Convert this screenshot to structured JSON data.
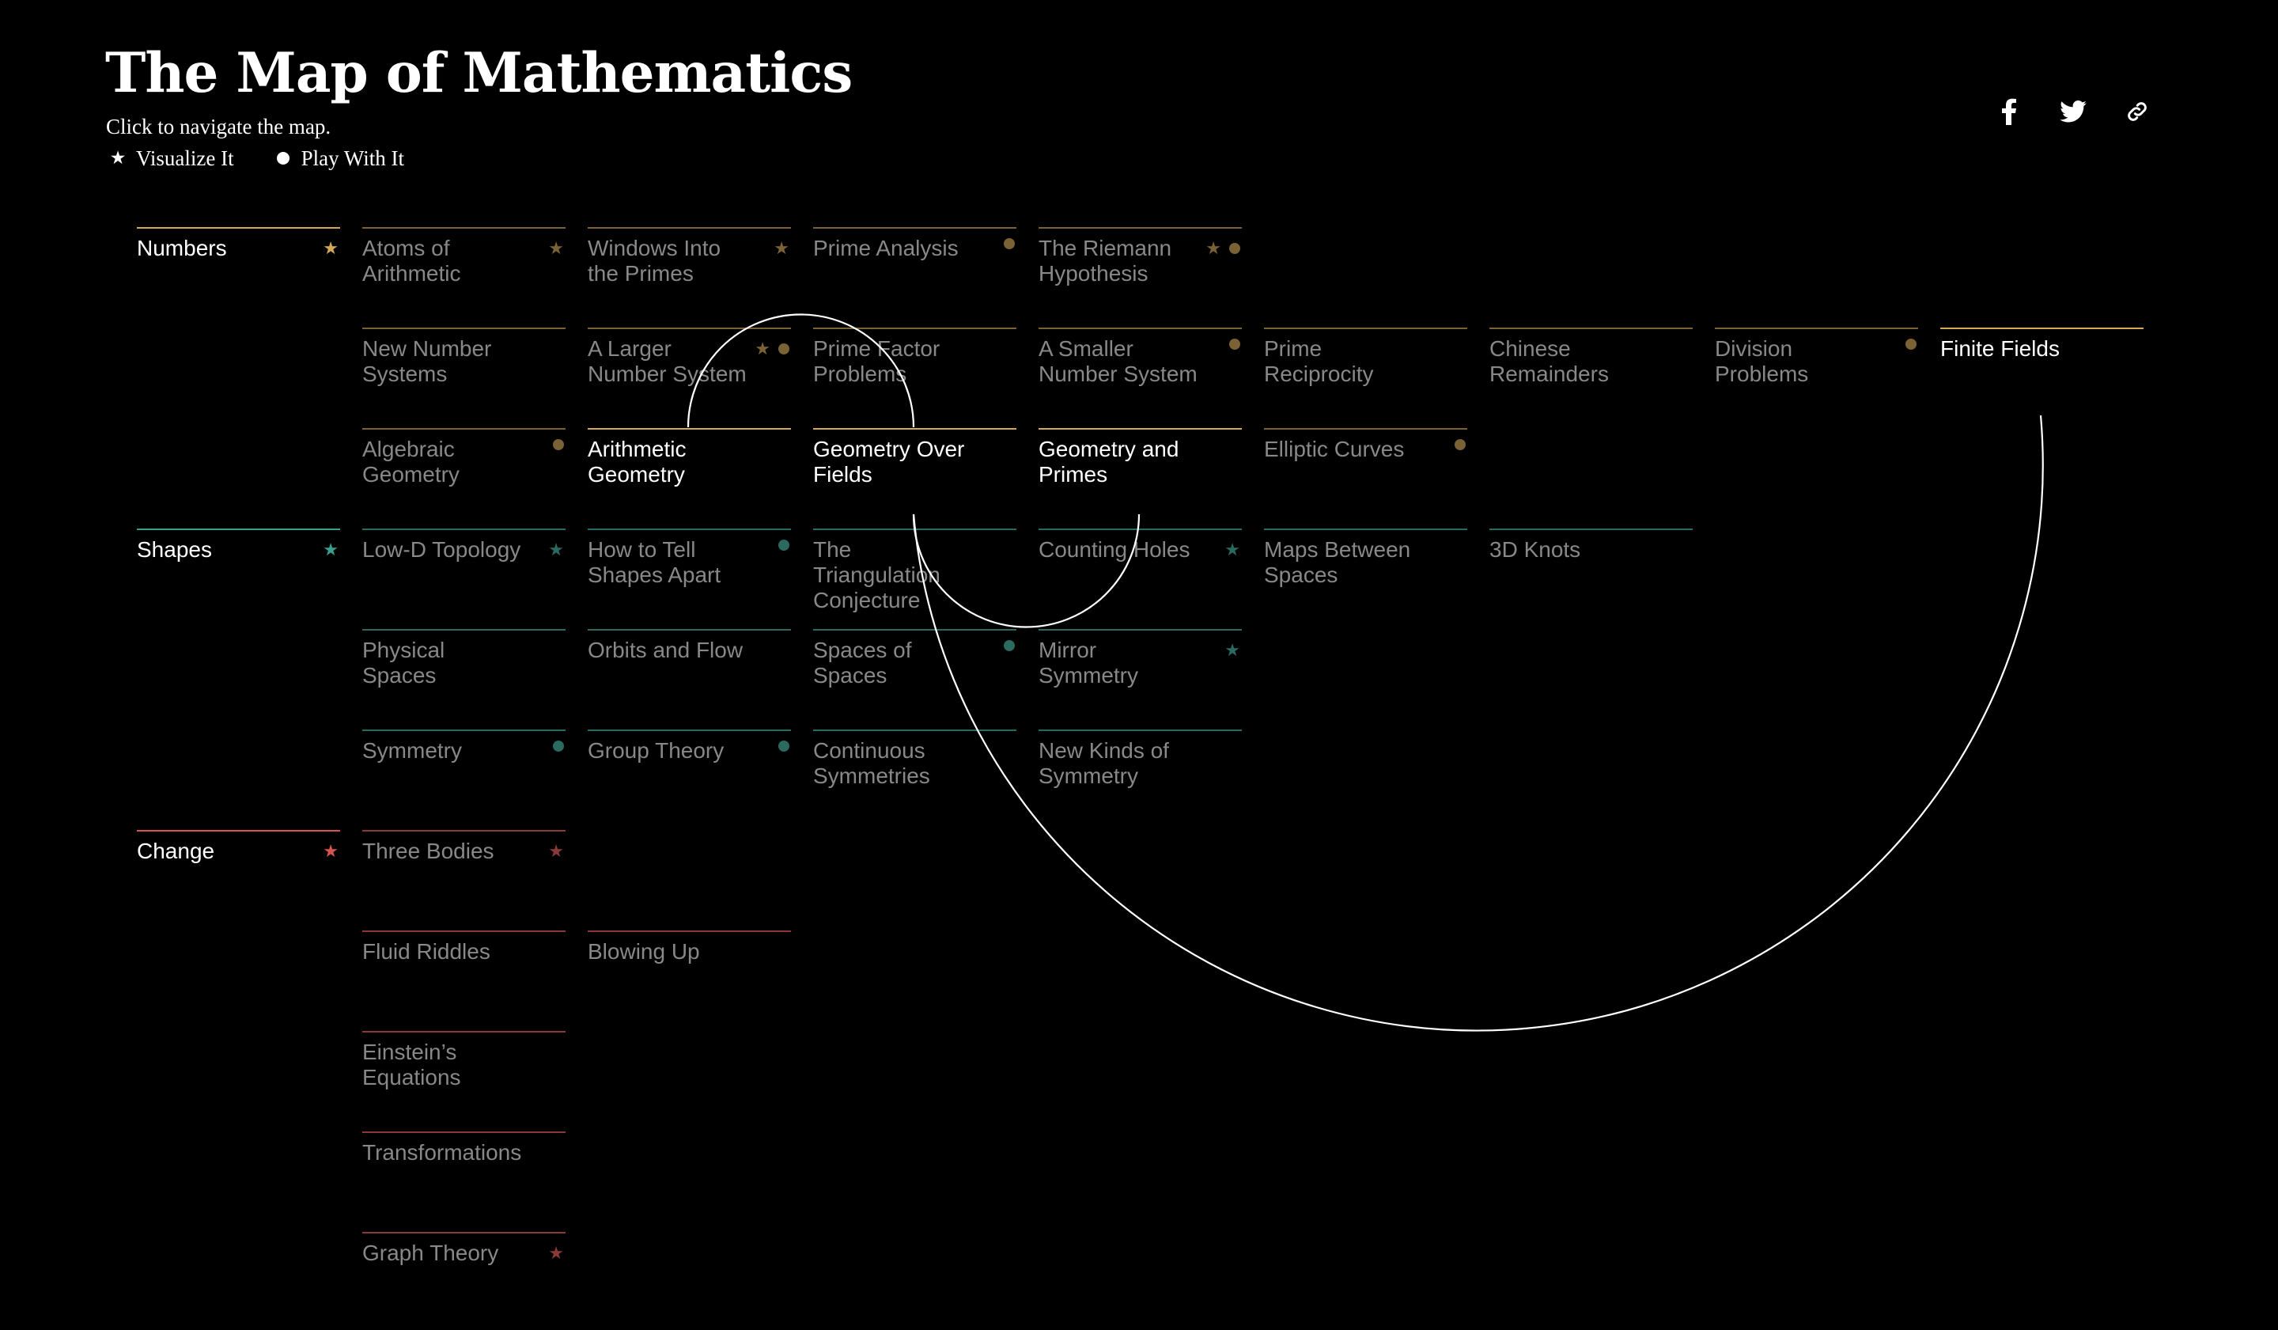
{
  "header": {
    "title": "The Map of Mathematics",
    "subtitle": "Click to navigate the map.",
    "legend": [
      {
        "icon": "star-icon",
        "glyph": "★",
        "label": "Visualize It"
      },
      {
        "icon": "dot-icon",
        "glyph": "●",
        "label": "Play With It"
      }
    ]
  },
  "share": [
    {
      "icon": "facebook-icon",
      "label": "Share on Facebook"
    },
    {
      "icon": "twitter-icon",
      "label": "Share on Twitter"
    },
    {
      "icon": "link-icon",
      "label": "Copy link"
    }
  ],
  "colors": {
    "background": "#000000",
    "numbers": "#d4a955",
    "shapes": "#3a9e8e",
    "change": "#d9534f",
    "text_dim": "#888888",
    "text_bright": "#ffffff",
    "arc": "#ffffff"
  },
  "map": {
    "sections": [
      {
        "name": "Numbers",
        "color": "#d4a955",
        "icon_color_dim": "#7a6235",
        "root": {
          "label": "Numbers",
          "star": true
        },
        "rows": [
          [
            {
              "label": "Atoms of Arithmetic",
              "star": true,
              "dot": false
            },
            {
              "label": "Windows Into the Primes",
              "star": true,
              "dot": false
            },
            {
              "label": "Prime Analysis",
              "star": false,
              "dot": true
            },
            {
              "label": "The Riemann Hypothesis",
              "star": true,
              "dot": true
            }
          ],
          [
            {
              "label": "New Number Systems",
              "star": false,
              "dot": false
            },
            {
              "label": "A Larger Number System",
              "star": true,
              "dot": true
            },
            {
              "label": "Prime Factor Problems",
              "star": false,
              "dot": false
            },
            {
              "label": "A Smaller Number System",
              "star": false,
              "dot": true
            },
            {
              "label": "Prime Reciprocity",
              "star": false,
              "dot": false
            },
            {
              "label": "Chinese Remainders",
              "star": false,
              "dot": false
            },
            {
              "label": "Division Problems",
              "star": false,
              "dot": true
            },
            {
              "label": "Finite Fields",
              "star": false,
              "dot": false,
              "highlight": true
            }
          ],
          [
            {
              "label": "Algebraic Geometry",
              "star": false,
              "dot": true
            },
            {
              "label": "Arithmetic Geometry",
              "star": false,
              "dot": false,
              "highlight": true
            },
            {
              "label": "Geometry Over Fields",
              "star": false,
              "dot": false,
              "highlight": true
            },
            {
              "label": "Geometry and Primes",
              "star": false,
              "dot": false,
              "highlight": true
            },
            {
              "label": "Elliptic Curves",
              "star": false,
              "dot": true
            }
          ]
        ]
      },
      {
        "name": "Shapes",
        "color": "#3a9e8e",
        "icon_color_dim": "#2a6a60",
        "root": {
          "label": "Shapes",
          "star": true
        },
        "rows": [
          [
            {
              "label": "Low-D Topology",
              "star": true,
              "dot": false
            },
            {
              "label": "How to Tell Shapes Apart",
              "star": false,
              "dot": true
            },
            {
              "label": "The Triangulation Conjecture",
              "star": false,
              "dot": false
            },
            {
              "label": "Counting Holes",
              "star": true,
              "dot": false
            },
            {
              "label": "Maps Between Spaces",
              "star": false,
              "dot": false
            },
            {
              "label": "3D Knots",
              "star": false,
              "dot": false
            }
          ],
          [
            {
              "label": "Physical Spaces",
              "star": false,
              "dot": false
            },
            {
              "label": "Orbits and Flow",
              "star": false,
              "dot": false
            },
            {
              "label": "Spaces of Spaces",
              "star": false,
              "dot": true
            },
            {
              "label": "Mirror Symmetry",
              "star": true,
              "dot": false
            }
          ],
          [
            {
              "label": "Symmetry",
              "star": false,
              "dot": true
            },
            {
              "label": "Group Theory",
              "star": false,
              "dot": true
            },
            {
              "label": "Continuous Symmetries",
              "star": false,
              "dot": false
            },
            {
              "label": "New Kinds of Symmetry",
              "star": false,
              "dot": false
            }
          ]
        ]
      },
      {
        "name": "Change",
        "color": "#d9534f",
        "icon_color_dim": "#8a3a38",
        "root": {
          "label": "Change",
          "star": true
        },
        "rows": [
          [
            {
              "label": "Three Bodies",
              "star": true,
              "dot": false
            }
          ],
          [
            {
              "label": "Fluid Riddles",
              "star": false,
              "dot": false
            },
            {
              "label": "Blowing Up",
              "star": false,
              "dot": false
            }
          ],
          [
            {
              "label": "Einstein’s Equations",
              "star": false,
              "dot": false
            }
          ],
          [
            {
              "label": "Transformations",
              "star": false,
              "dot": false
            }
          ],
          [
            {
              "label": "Graph Theory",
              "star": true,
              "dot": false
            }
          ]
        ]
      }
    ]
  }
}
